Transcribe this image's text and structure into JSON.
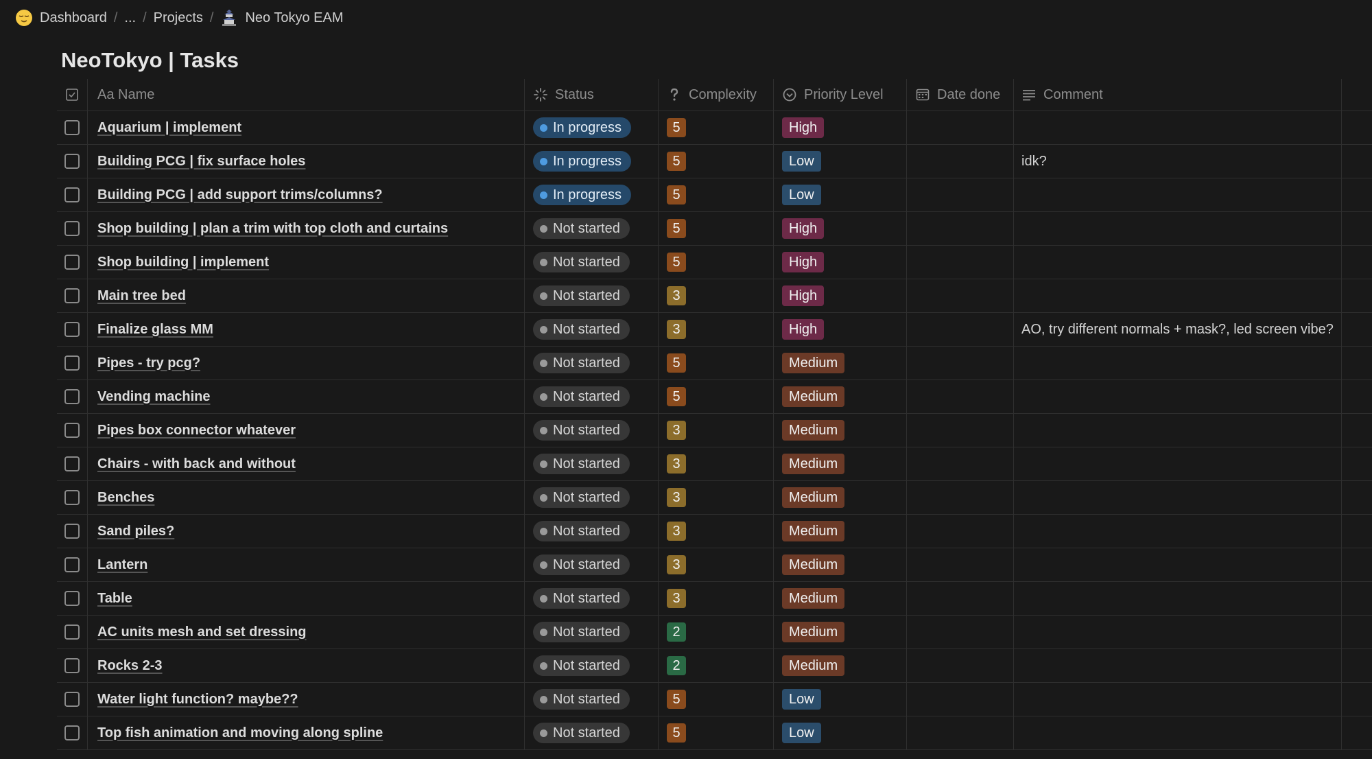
{
  "breadcrumb": {
    "items": [
      {
        "label": "Dashboard",
        "icon": "relieved-face-icon"
      },
      {
        "label": "..."
      },
      {
        "label": "Projects"
      },
      {
        "label": "Neo Tokyo EAM",
        "icon": "tokyo-building-icon"
      }
    ]
  },
  "page": {
    "title": "NeoTokyo | Tasks"
  },
  "columns": {
    "name": "Aa Name",
    "status": "Status",
    "complexity": "Complexity",
    "priority": "Priority Level",
    "date_done": "Date done",
    "comment": "Comment"
  },
  "colors": {
    "complexity": {
      "5": "#8a4b1d",
      "3": "#8c6d2b",
      "2": "#2a6a45"
    },
    "priority": {
      "High": "#6d2a48",
      "Low": "#2b4d6b",
      "Medium": "#6b3a27"
    }
  },
  "rows": [
    {
      "name": "Aquarium | implement",
      "status": "In progress",
      "complexity": "5",
      "priority": "High",
      "date_done": "",
      "comment": ""
    },
    {
      "name": "Building PCG | fix surface holes",
      "status": "In progress",
      "complexity": "5",
      "priority": "Low",
      "date_done": "",
      "comment": "idk?"
    },
    {
      "name": "Building PCG | add support trims/columns?",
      "status": "In progress",
      "complexity": "5",
      "priority": "Low",
      "date_done": "",
      "comment": ""
    },
    {
      "name": "Shop building | plan a trim with top cloth and curtains",
      "status": "Not started",
      "complexity": "5",
      "priority": "High",
      "date_done": "",
      "comment": ""
    },
    {
      "name": "Shop building | implement",
      "status": "Not started",
      "complexity": "5",
      "priority": "High",
      "date_done": "",
      "comment": ""
    },
    {
      "name": "Main tree bed",
      "status": "Not started",
      "complexity": "3",
      "priority": "High",
      "date_done": "",
      "comment": ""
    },
    {
      "name": "Finalize glass MM",
      "status": "Not started",
      "complexity": "3",
      "priority": "High",
      "date_done": "",
      "comment": "AO, try different normals + mask?, led screen vibe?"
    },
    {
      "name": "Pipes - try pcg?",
      "status": "Not started",
      "complexity": "5",
      "priority": "Medium",
      "date_done": "",
      "comment": ""
    },
    {
      "name": "Vending machine",
      "status": "Not started",
      "complexity": "5",
      "priority": "Medium",
      "date_done": "",
      "comment": ""
    },
    {
      "name": "Pipes box connector whatever",
      "status": "Not started",
      "complexity": "3",
      "priority": "Medium",
      "date_done": "",
      "comment": ""
    },
    {
      "name": "Chairs - with back and without",
      "status": "Not started",
      "complexity": "3",
      "priority": "Medium",
      "date_done": "",
      "comment": ""
    },
    {
      "name": "Benches",
      "status": "Not started",
      "complexity": "3",
      "priority": "Medium",
      "date_done": "",
      "comment": ""
    },
    {
      "name": "Sand piles?",
      "status": "Not started",
      "complexity": "3",
      "priority": "Medium",
      "date_done": "",
      "comment": ""
    },
    {
      "name": "Lantern",
      "status": "Not started",
      "complexity": "3",
      "priority": "Medium",
      "date_done": "",
      "comment": ""
    },
    {
      "name": "Table",
      "status": "Not started",
      "complexity": "3",
      "priority": "Medium",
      "date_done": "",
      "comment": ""
    },
    {
      "name": "AC units mesh and set dressing",
      "status": "Not started",
      "complexity": "2",
      "priority": "Medium",
      "date_done": "",
      "comment": ""
    },
    {
      "name": "Rocks 2-3",
      "status": "Not started",
      "complexity": "2",
      "priority": "Medium",
      "date_done": "",
      "comment": ""
    },
    {
      "name": "Water light function? maybe??",
      "status": "Not started",
      "complexity": "5",
      "priority": "Low",
      "date_done": "",
      "comment": ""
    },
    {
      "name": "Top fish animation and moving along spline",
      "status": "Not started",
      "complexity": "5",
      "priority": "Low",
      "date_done": "",
      "comment": ""
    }
  ]
}
